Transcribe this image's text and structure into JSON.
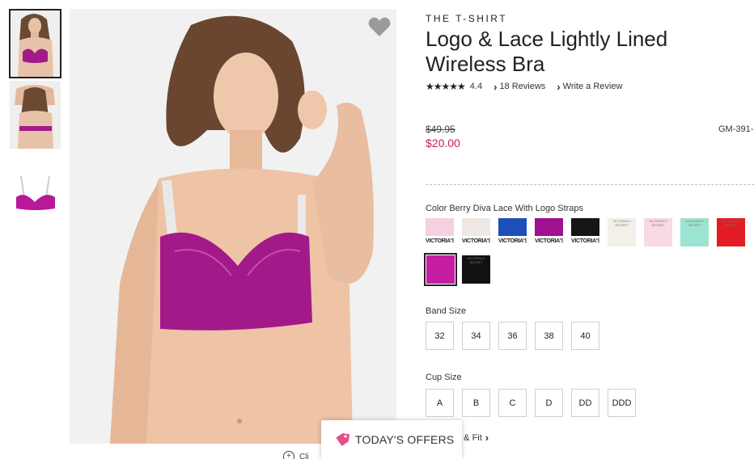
{
  "product": {
    "brand": "THE T-SHIRT",
    "title": "Logo & Lace Lightly Lined Wireless Bra",
    "rating": "4.4",
    "stars": "★★★★★",
    "reviews_link": "18 Reviews",
    "write_review_link": "Write a Review",
    "old_price": "$49.95",
    "new_price": "$20.00",
    "sku": "GM-391-"
  },
  "color": {
    "label": "Color Berry Diva Lace With Logo Straps",
    "swatches": [
      {
        "strap_text": "VICTORIA'S",
        "color": "#f6cfe0"
      },
      {
        "strap_text": "VICTORIA'S",
        "color": "#efe8e4"
      },
      {
        "strap_text": "VICTORIA'S",
        "color": "#1d4fb8"
      },
      {
        "strap_text": "VICTORIA'S",
        "color": "#a0108f"
      },
      {
        "strap_text": "VICTORIA'S",
        "color": "#151515"
      },
      {
        "tiny_text": "VICTORIA'S SECRET",
        "color": "#f3efe9"
      },
      {
        "tiny_text": "VICTORIA'S SECRET",
        "color": "#f8d9e6"
      },
      {
        "tiny_text": "VICTORIA'S SECRET",
        "color": "#9de3d2"
      },
      {
        "tiny_text": "VICTORIA'S SECRET",
        "color": "#e21b25"
      },
      {
        "color": "#c51ea3"
      },
      {
        "tiny_text": "VICTORIA'S SECRET",
        "color": "#111111"
      }
    ]
  },
  "band": {
    "label": "Band Size",
    "sizes": [
      "32",
      "34",
      "36",
      "38",
      "40"
    ]
  },
  "cup": {
    "label": "Cup Size",
    "sizes": [
      "A",
      "B",
      "C",
      "D",
      "DD",
      "DDD"
    ]
  },
  "fit_link": "e & Fit",
  "offers": {
    "label": "TODAY'S OFFERS"
  },
  "zoom": {
    "label": "Cli"
  },
  "colors": {
    "accent_price": "#c8204f",
    "product_berry": "#a21a8a"
  },
  "icons": {
    "favorite": "heart-icon",
    "offers": "tag-icon",
    "zoom": "zoom-plus-icon"
  }
}
